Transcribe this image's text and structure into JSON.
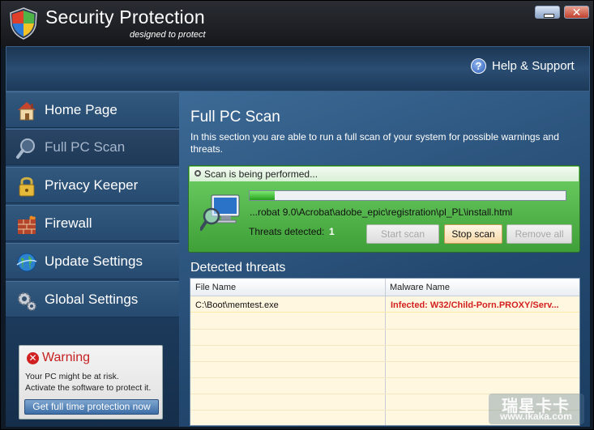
{
  "app": {
    "title": "Security Protection",
    "subtitle": "designed to protect"
  },
  "header": {
    "help_label": "Help & Support"
  },
  "sidebar": {
    "items": [
      {
        "label": "Home Page",
        "icon": "house-icon",
        "active": false
      },
      {
        "label": "Full PC Scan",
        "icon": "magnifier-icon",
        "active": true
      },
      {
        "label": "Privacy Keeper",
        "icon": "padlock-icon",
        "active": false
      },
      {
        "label": "Firewall",
        "icon": "brick-wall-icon",
        "active": false
      },
      {
        "label": "Update Settings",
        "icon": "globe-icon",
        "active": false
      },
      {
        "label": "Global Settings",
        "icon": "gears-icon",
        "active": false
      }
    ],
    "warning": {
      "title": "Warning",
      "line1": "Your PC might be at risk.",
      "line2": "Activate the software to protect it.",
      "button": "Get full time protection now"
    }
  },
  "main": {
    "title": "Full PC Scan",
    "description": "In this section you are able to run a full scan of your system for possible warnings and threats.",
    "scan": {
      "status": "Scan is being performed...",
      "progress": 0.08,
      "current_path": "...robat 9.0\\Acrobat\\adobe_epic\\registration\\pl_PL\\install.html",
      "threats_label": "Threats detected:",
      "threats_count": "1",
      "buttons": {
        "start": "Start scan",
        "stop": "Stop scan",
        "remove": "Remove all"
      }
    },
    "threats": {
      "title": "Detected threats",
      "columns": [
        "File Name",
        "Malware Name"
      ],
      "rows": [
        {
          "file": "C:\\Boot\\memtest.exe",
          "malware": "Infected: W32/Child-Porn.PROXY/Serv..."
        }
      ]
    }
  },
  "watermark": {
    "line1": "瑞星卡卡",
    "line2": "www.ikaka.com"
  },
  "colors": {
    "scan_green": "#4fb447",
    "threat_red": "#d32020",
    "nav_blue": "#2c5279"
  }
}
